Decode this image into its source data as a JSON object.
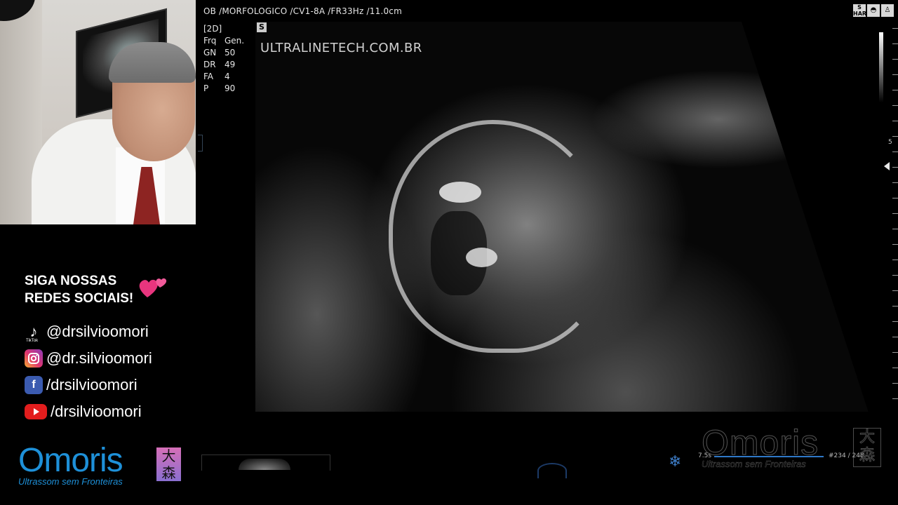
{
  "header": {
    "status_line": "OB /MORFOLOGICO /CV1-8A /FR33Hz /11.0cm"
  },
  "params": {
    "mode": "[2D]",
    "rows": [
      {
        "k": "Frq",
        "v": "Gen."
      },
      {
        "k": "GN",
        "v": "50"
      },
      {
        "k": "DR",
        "v": "49"
      },
      {
        "k": "FA",
        "v": "4"
      },
      {
        "k": "P",
        "v": "90"
      }
    ]
  },
  "top_icons": [
    "S HAR",
    "probe-icon",
    "person-icon"
  ],
  "scan": {
    "marker": "S",
    "watermark": "ULTRALINETECH.COM.BR",
    "depth_label": "5"
  },
  "social": {
    "title_line1": "SIGA NOSSAS",
    "title_line2": "REDES SOCIAIS!",
    "tiktok": "@drsilvioomori",
    "tiktok_caption": "TikTok",
    "instagram": "@dr.silvioomori",
    "facebook": "/drsilvioomori",
    "youtube": "/drsilvioomori"
  },
  "logo": {
    "word": "Omoris",
    "kanji": "大森",
    "tagline": "Ultrassom sem Fronteiras"
  },
  "cine": {
    "start": "7.5s",
    "frame": "#234 / 248"
  },
  "colors": {
    "brand_blue": "#1e90d8",
    "kanji_gradient_top": "#d76fb8",
    "instagram_pink": "#e0356e",
    "facebook_blue": "#3b5bb0",
    "youtube_red": "#e21d1d",
    "cine_blue": "#2f78c7"
  }
}
